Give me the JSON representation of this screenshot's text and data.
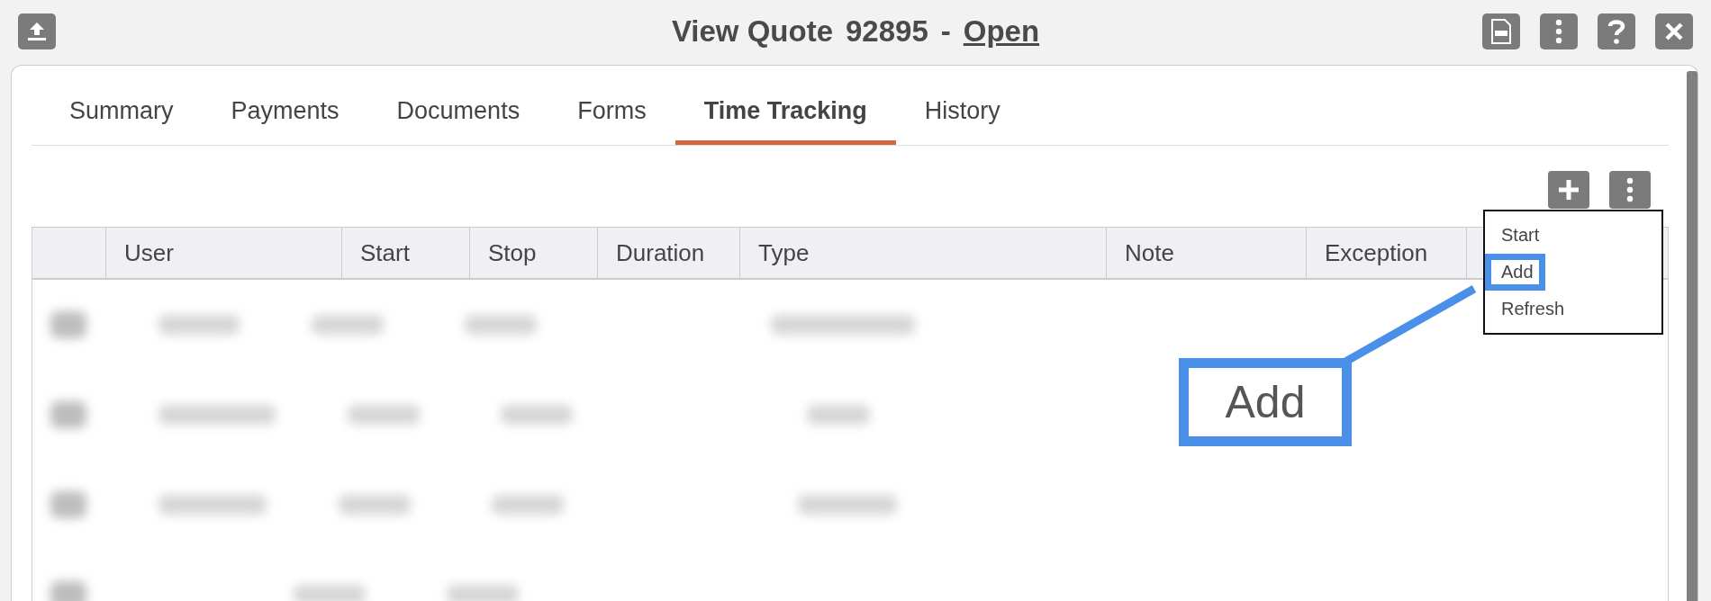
{
  "window": {
    "title": "View Quote",
    "number": "92895",
    "separator": "-",
    "status": "Open"
  },
  "tabs": [
    {
      "label": "Summary",
      "selected": false
    },
    {
      "label": "Payments",
      "selected": false
    },
    {
      "label": "Documents",
      "selected": false
    },
    {
      "label": "Forms",
      "selected": false
    },
    {
      "label": "Time Tracking",
      "selected": true
    },
    {
      "label": "History",
      "selected": false
    }
  ],
  "table": {
    "columns": [
      "User",
      "Start",
      "Stop",
      "Duration",
      "Type",
      "Note",
      "Exception"
    ]
  },
  "menu": {
    "items": [
      {
        "label": "Start",
        "highlighted": false
      },
      {
        "label": "Add",
        "highlighted": true
      },
      {
        "label": "Refresh",
        "highlighted": false
      }
    ]
  },
  "callout": {
    "text": "Add"
  }
}
